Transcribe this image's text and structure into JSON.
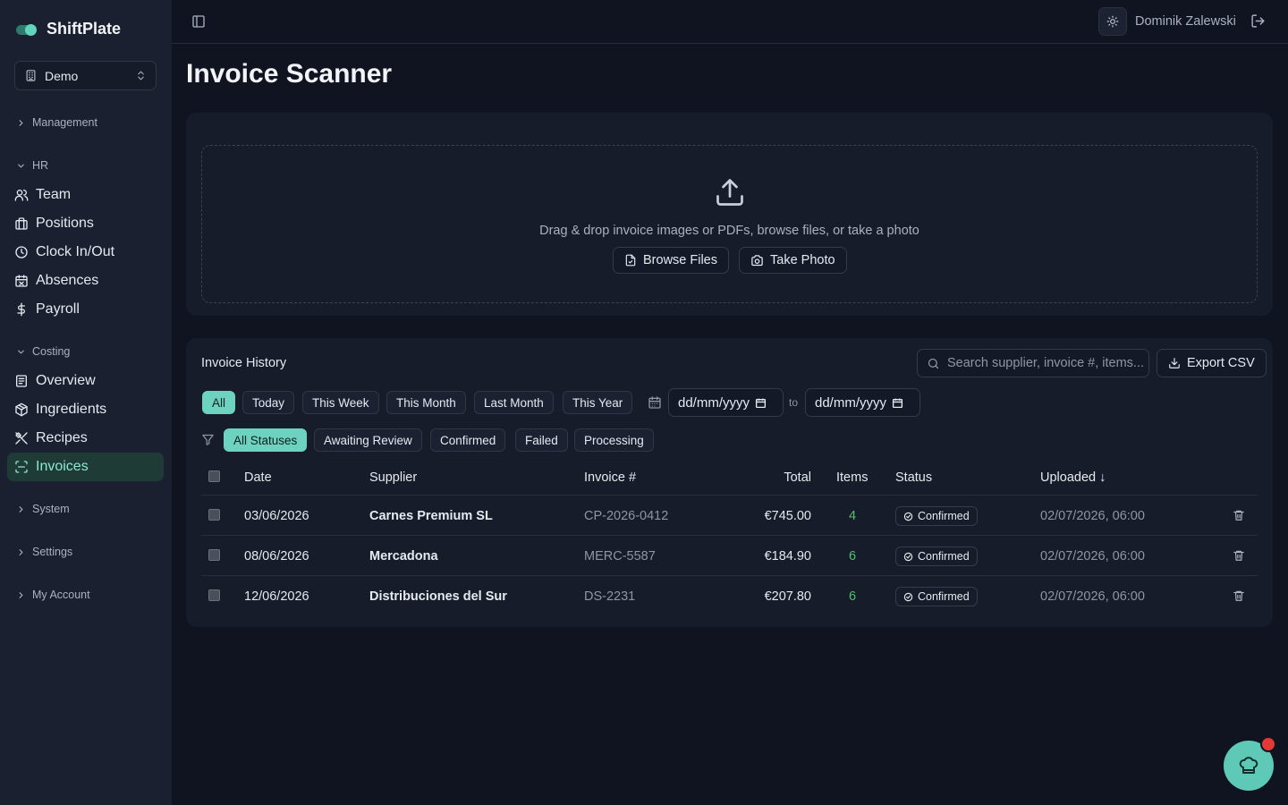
{
  "app": {
    "name": "ShiftPlate",
    "org": "Demo"
  },
  "sidebar": {
    "sections": {
      "management": "Management",
      "hr": "HR",
      "costing": "Costing",
      "system": "System",
      "settings": "Settings",
      "my_account": "My Account"
    },
    "hr_items": [
      "Team",
      "Positions",
      "Clock In/Out",
      "Absences",
      "Payroll"
    ],
    "costing_items": [
      "Overview",
      "Ingredients",
      "Recipes",
      "Invoices"
    ],
    "active_item": "Invoices"
  },
  "topbar": {
    "user_name": "Dominik Zalewski"
  },
  "page": {
    "title": "Invoice Scanner"
  },
  "upload": {
    "text": "Drag & drop invoice images or PDFs, browse files, or take a photo",
    "browse_label": "Browse Files",
    "photo_label": "Take Photo"
  },
  "history": {
    "title": "Invoice History",
    "search_placeholder": "Search supplier, invoice #, items...",
    "export_label": "Export CSV",
    "date_filters": [
      "All",
      "Today",
      "This Week",
      "This Month",
      "Last Month",
      "This Year"
    ],
    "active_date_filter": "All",
    "date_from": "dd/mm/yyyy",
    "date_to": "dd/mm/yyyy",
    "to_label": "to",
    "status_filters": [
      "All Statuses",
      "Awaiting Review",
      "Confirmed",
      "Failed",
      "Processing"
    ],
    "active_status_filter": "All Statuses",
    "columns": {
      "date": "Date",
      "supplier": "Supplier",
      "invoice": "Invoice #",
      "total": "Total",
      "items": "Items",
      "status": "Status",
      "uploaded": "Uploaded ↓"
    },
    "rows": [
      {
        "date": "03/06/2026",
        "supplier": "Carnes Premium SL",
        "invoice": "CP-2026-0412",
        "total": "€745.00",
        "items": "4",
        "status": "Confirmed",
        "uploaded": "02/07/2026, 06:00"
      },
      {
        "date": "08/06/2026",
        "supplier": "Mercadona",
        "invoice": "MERC-5587",
        "total": "€184.90",
        "items": "6",
        "status": "Confirmed",
        "uploaded": "02/07/2026, 06:00"
      },
      {
        "date": "12/06/2026",
        "supplier": "Distribuciones del Sur",
        "invoice": "DS-2231",
        "total": "€207.80",
        "items": "6",
        "status": "Confirmed",
        "uploaded": "02/07/2026, 06:00"
      }
    ]
  },
  "colors": {
    "accent": "#6dd3c0",
    "active_nav_bg": "#1f3b36",
    "items_green": "#4fc06d",
    "notification": "#e53935"
  },
  "icons": [
    "sidebar-toggle-icon",
    "sun-icon",
    "logout-icon",
    "upload-icon",
    "file-icon",
    "camera-icon",
    "search-icon",
    "download-icon",
    "calendar-icon",
    "filter-icon",
    "check-circle-icon",
    "trash-icon",
    "chef-hat-icon"
  ]
}
